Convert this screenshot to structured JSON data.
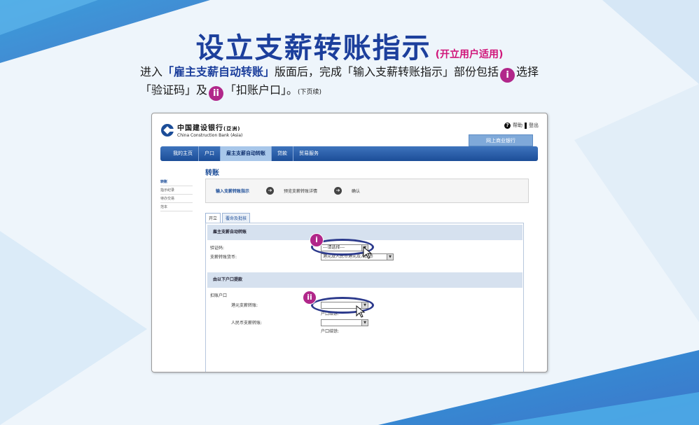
{
  "page": {
    "title": "设立支薪转账指示",
    "subtitle": "(开立用户适用)",
    "intro": {
      "p1": "进入",
      "highlight": "「雇主支薪自动转账」",
      "p2": "版面后，完成「输入支薪转账指示」部份包括",
      "marker_i": "i",
      "p3": "选择",
      "p4": "「验证码」及",
      "marker_ii": "ii",
      "p5": "「扣账户口」。",
      "continued": "(下页续)"
    }
  },
  "screenshot": {
    "bank_cn": "中国建设银行",
    "bank_region": "(亞洲)",
    "bank_en": "China Construction Bank (Asia)",
    "help": "帮助",
    "logout": "登出",
    "ebank": "网上商业银行",
    "nav": [
      "我的主页",
      "户口",
      "雇主支薪自动转账",
      "贷款",
      "贸易服务"
    ],
    "sidebar": [
      "转账",
      "指示纪录",
      "待办交易",
      "范本"
    ],
    "page_title": "转账",
    "steps": [
      "输入支薪转账指示",
      "预览支薪转账详情",
      "确认"
    ],
    "tabs": [
      "开立",
      "覆命及批核"
    ],
    "section1": "雇主支薪自动转账",
    "verify_label": "验证码:",
    "verify_value": "---请选择---",
    "currency_label": "支薪转账货币:",
    "currency_value": "港元及人民币港元及人民币",
    "section2": "由以下户口提款",
    "debit_label": "扣账户口",
    "hkd_label": "港元支薪转账:",
    "rmb_label": "人民币支薪转账:",
    "balance_label": "户口结馀:",
    "marker_i": "i",
    "marker_ii": "ii"
  },
  "colors": {
    "title_blue": "#1c3f9c",
    "subtitle_magenta": "#d0167a",
    "marker_purple": "#b1278a",
    "nav_blue": "#1c4d98"
  }
}
